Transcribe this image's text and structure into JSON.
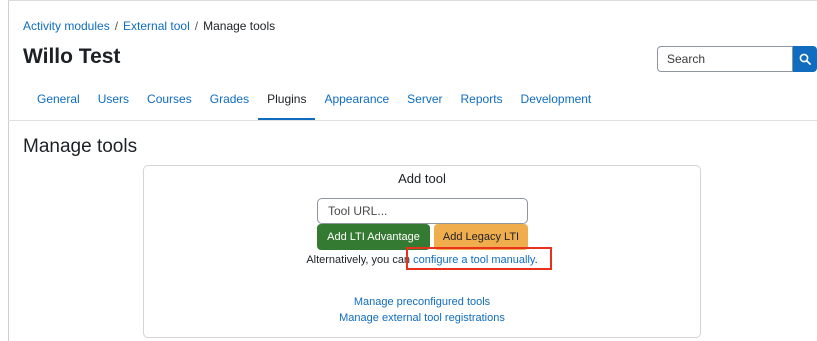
{
  "breadcrumb": {
    "items": [
      "Activity modules",
      "External tool",
      "Manage tools"
    ],
    "separator": "/"
  },
  "site": {
    "title": "Willo Test"
  },
  "search": {
    "placeholder": "Search",
    "value": ""
  },
  "tabs": [
    {
      "label": "General",
      "active": false
    },
    {
      "label": "Users",
      "active": false
    },
    {
      "label": "Courses",
      "active": false
    },
    {
      "label": "Grades",
      "active": false
    },
    {
      "label": "Plugins",
      "active": true
    },
    {
      "label": "Appearance",
      "active": false
    },
    {
      "label": "Server",
      "active": false
    },
    {
      "label": "Reports",
      "active": false
    },
    {
      "label": "Development",
      "active": false
    }
  ],
  "page": {
    "heading": "Manage tools"
  },
  "add_tool": {
    "title": "Add tool",
    "url_placeholder": "Tool URL...",
    "url_value": "",
    "advantage_label": "Add LTI Advantage",
    "legacy_label": "Add Legacy LTI",
    "alt_text": "Alternatively, you can",
    "manual_link": "configure a tool manually",
    "manual_suffix": "."
  },
  "links": {
    "preconfigured": "Manage preconfigured tools",
    "registrations": "Manage external tool registrations"
  },
  "colors": {
    "link": "#0f6cbf",
    "primary": "#0f6cbf",
    "success": "#357a32",
    "warning": "#f0ad4e",
    "highlight": "#e8301c"
  },
  "icons": {
    "search": "search-icon"
  }
}
